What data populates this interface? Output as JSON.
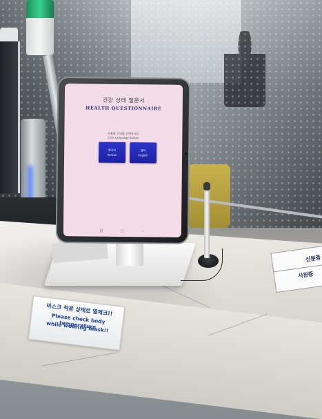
{
  "screen": {
    "title_ko": "건강 상태 질문서",
    "title_en": "HEALTH QUESTIONNAIRE",
    "instruction_ko": "사용할 언어를 선택하세요",
    "instruction_en": "Click Language Button",
    "buttons": [
      {
        "label_ko": "한국어",
        "label_en": "Korean"
      },
      {
        "label_ko": "영어",
        "label_en": "English"
      }
    ],
    "nav": {
      "menu_icon": "menu-lines-icon",
      "home_icon": "home-square-icon",
      "back_icon": "back-chevron-icon"
    },
    "colors": {
      "background": "#f3dbe8",
      "button": "#2e34c9",
      "title_en": "#2b2f7a"
    }
  },
  "signs": {
    "notice_line1": "마스크 착용 상태로 열체크!!",
    "notice_line2": "Please check body temperature",
    "notice_line3": "while wearing mask!!",
    "visitor_line1": "신분증",
    "visitor_line2": "사원증"
  }
}
